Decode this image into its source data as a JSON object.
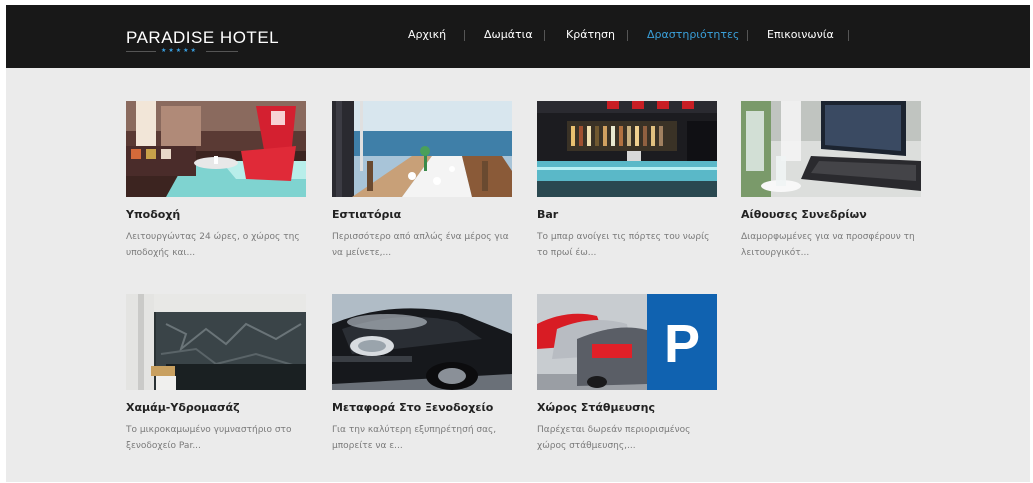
{
  "brand": {
    "name": "PARADISE HOTEL",
    "stars": "★★★★★",
    "accent": "#3a9fd9"
  },
  "nav": {
    "items": [
      {
        "label": "Αρχική",
        "active": false
      },
      {
        "label": "Δωμάτια",
        "active": false
      },
      {
        "label": "Κράτηση",
        "active": false
      },
      {
        "label": "Δραστηριότητες",
        "active": true
      },
      {
        "label": "Επικοινωνία",
        "active": false
      }
    ]
  },
  "cards": [
    {
      "title": "Υποδοχή",
      "desc_line1": "Λειτουργώντας 24 ώρες, ο χώρος της",
      "desc_line2": "υποδοχής και..."
    },
    {
      "title": "Εστιατόρια",
      "desc_line1": "Περισσότερο από απλώς ένα μέρος για",
      "desc_line2": "να μείνετε,..."
    },
    {
      "title": "Bar",
      "desc_line1": "Το μπαρ ανοίγει τις πόρτες του νωρίς",
      "desc_line2": "το πρωί έω..."
    },
    {
      "title": "Αίθουσες Συνεδρίων",
      "desc_line1": "Διαμορφωμένες για να προσφέρουν τη",
      "desc_line2": "λειτουργικότ..."
    },
    {
      "title": "Χαμάμ-Υδρομασάζ",
      "desc_line1": "Το μικροκαμωμένο γυμναστήριο στο",
      "desc_line2": "ξενοδοχείο Par..."
    },
    {
      "title": "Μεταφορά Στο Ξενοδοχείο",
      "desc_line1": "Για την καλύτερη εξυπηρέτησή σας,",
      "desc_line2": "μπορείτε να ε..."
    },
    {
      "title": "Χώρος Στάθμευσης",
      "desc_line1": "Παρέχεται δωρεάν περιορισμένος",
      "desc_line2": "χώρος στάθμευσης,..."
    }
  ],
  "parking_sign": "P"
}
